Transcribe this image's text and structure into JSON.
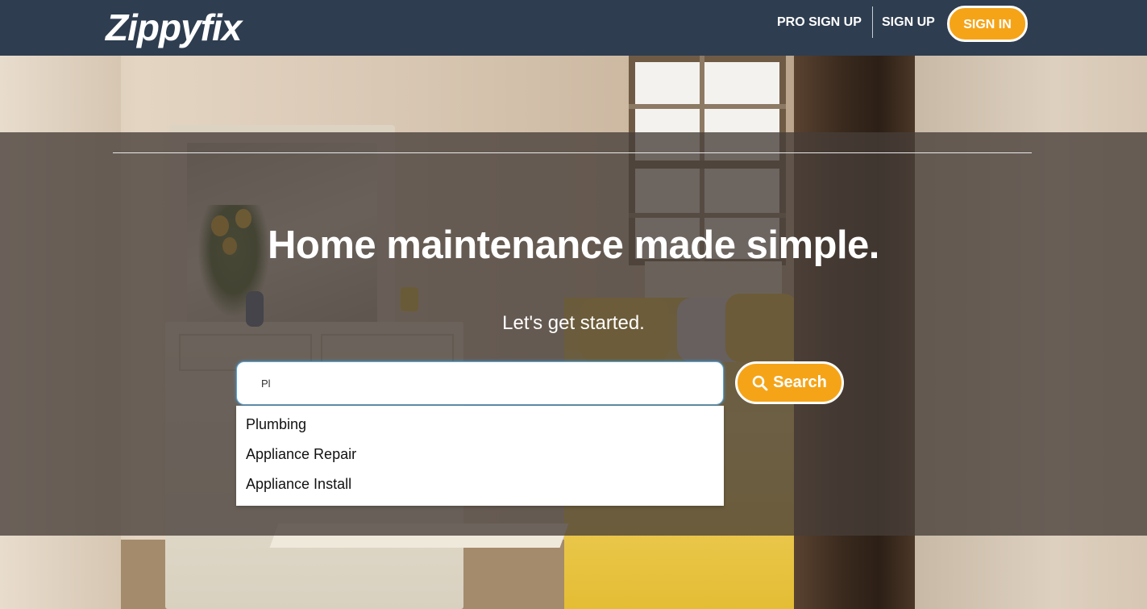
{
  "header": {
    "logo": "Zippyfix",
    "nav": {
      "pro_sign_up": "PRO SIGN UP",
      "sign_up": "SIGN UP",
      "sign_in": "SIGN IN"
    }
  },
  "hero": {
    "headline": "Home maintenance made simple.",
    "subhead": "Let's get started."
  },
  "search": {
    "value": "Pl",
    "button_label": "Search",
    "suggestions": [
      "Plumbing",
      "Appliance Repair",
      "Appliance Install"
    ]
  },
  "colors": {
    "header_bg": "#2e3d50",
    "accent": "#f5a418",
    "overlay": "#463e38"
  },
  "icons": {
    "search": "search-icon"
  }
}
